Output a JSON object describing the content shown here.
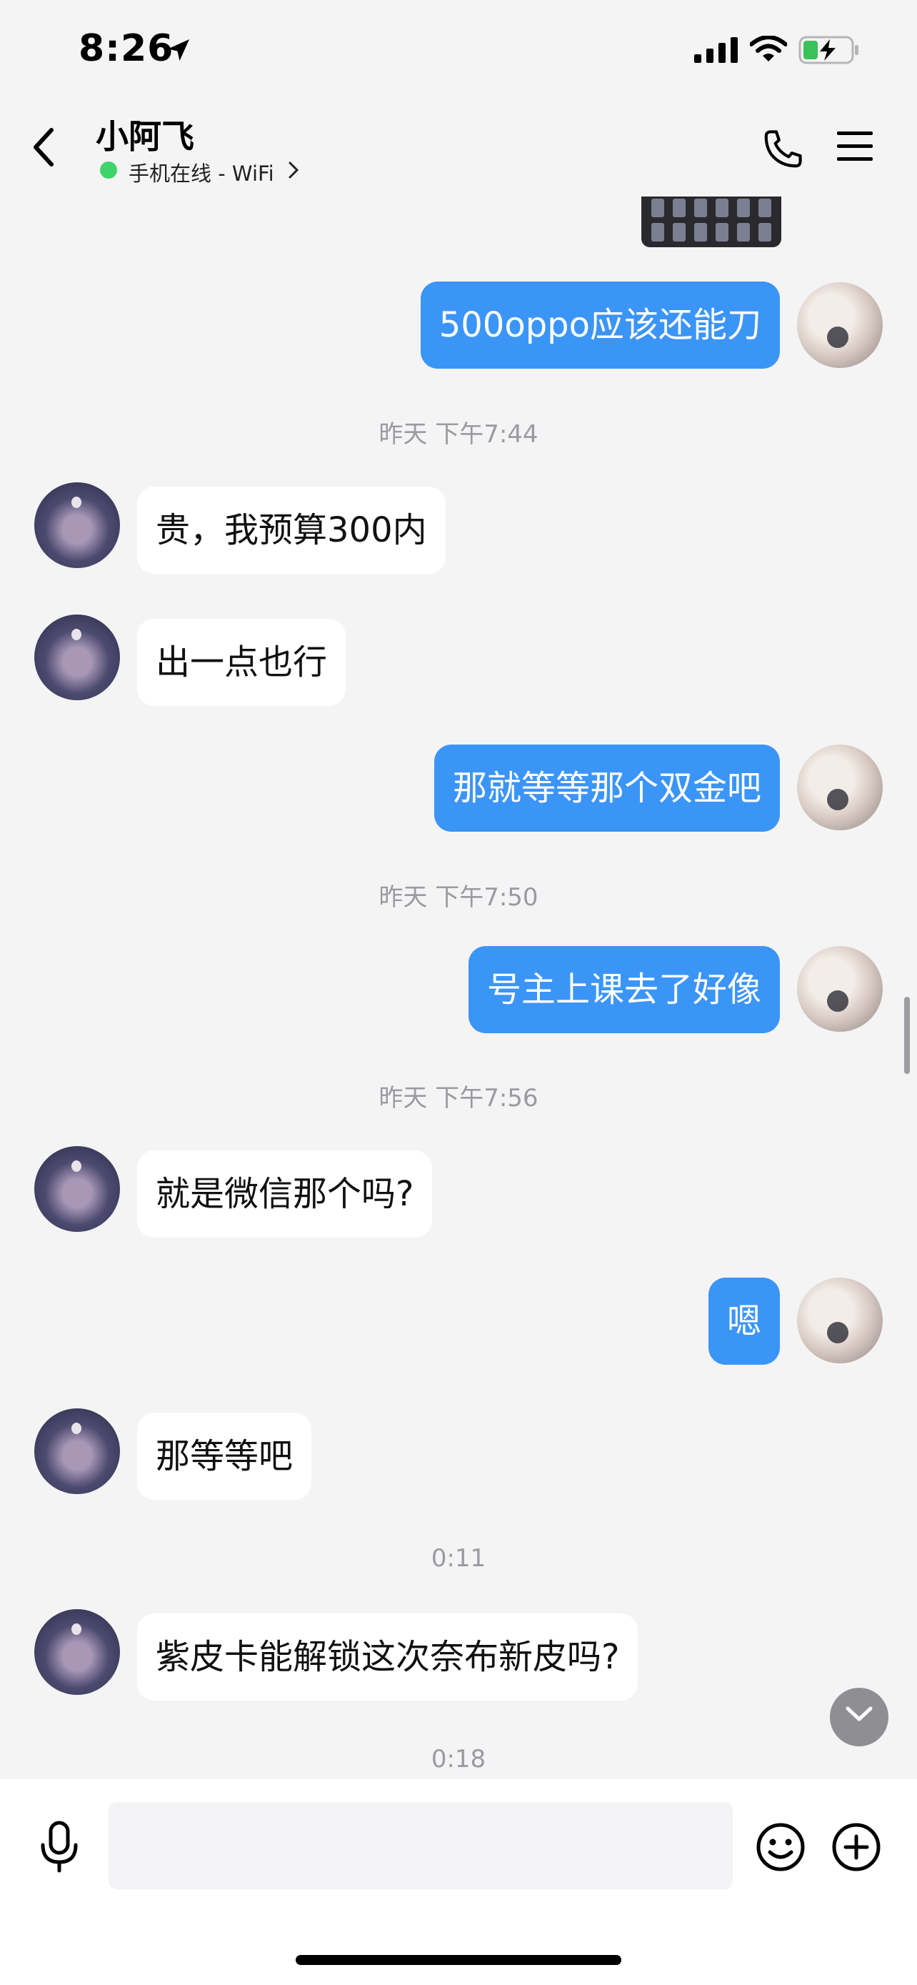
{
  "status_bar": {
    "time": "8:26"
  },
  "header": {
    "contact_name": "小阿飞",
    "online_status": "手机在线 - WiFi"
  },
  "messages": [
    {
      "side": "mine",
      "text": "500oppo应该还能刀"
    },
    {
      "time": "昨天 下午7:44"
    },
    {
      "side": "theirs",
      "text": "贵，我预算300内"
    },
    {
      "side": "theirs",
      "text": "出一点也行"
    },
    {
      "side": "mine",
      "text": "那就等等那个双金吧"
    },
    {
      "time": "昨天 下午7:50"
    },
    {
      "side": "mine",
      "text": "号主上课去了好像"
    },
    {
      "time": "昨天 下午7:56"
    },
    {
      "side": "theirs",
      "text": "就是微信那个吗?"
    },
    {
      "side": "mine",
      "text": "嗯"
    },
    {
      "side": "theirs",
      "text": "那等等吧"
    },
    {
      "time": "0:11"
    },
    {
      "side": "theirs",
      "text": "紫皮卡能解锁这次奈布新皮吗?"
    },
    {
      "time": "0:18"
    }
  ],
  "input": {
    "placeholder": "",
    "value": ""
  },
  "colors": {
    "my_bubble": "#3b95f7",
    "their_bubble": "#ffffff",
    "background": "#f4f4f5",
    "online_dot": "#3ed46a",
    "timestamp": "#9a9aa0"
  },
  "icons": [
    "location-arrow-icon",
    "signal-icon",
    "wifi-icon",
    "battery-charging-icon",
    "back-icon",
    "chevron-right-icon",
    "phone-icon",
    "menu-icon",
    "scroll-down-icon",
    "microphone-icon",
    "emoji-icon",
    "plus-icon"
  ]
}
